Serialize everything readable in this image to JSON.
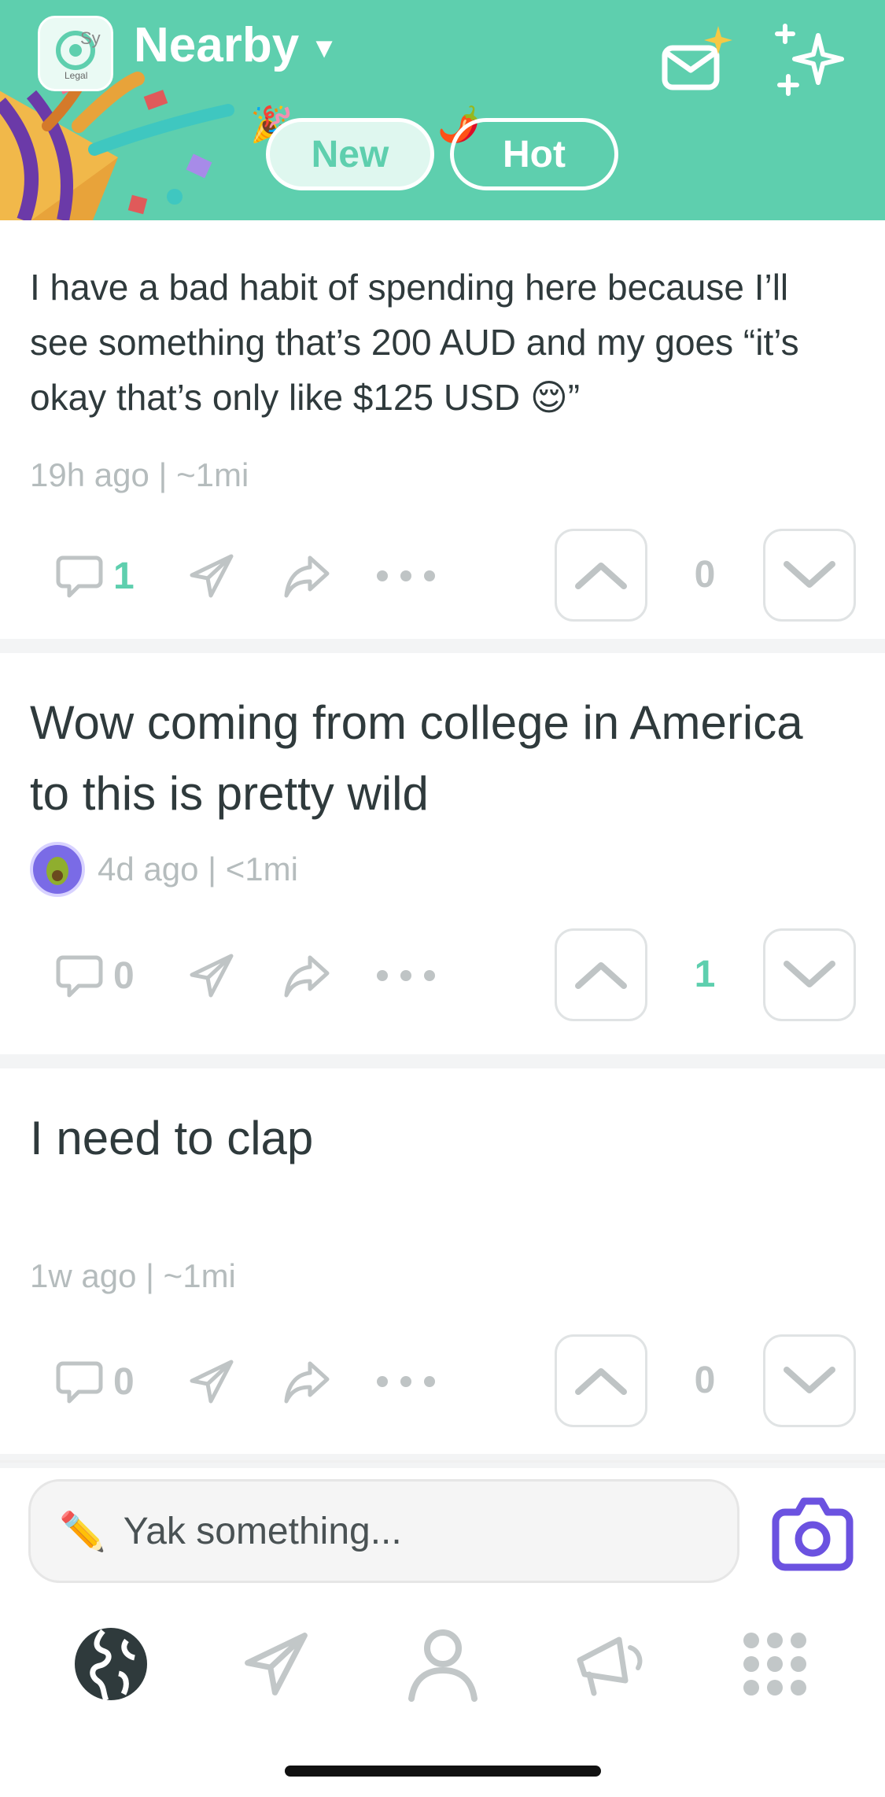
{
  "header": {
    "logo_text": "Sy",
    "logo_sub": "Legal",
    "title": "Nearby",
    "tabs": [
      {
        "label": "New",
        "active": true
      },
      {
        "label": "Hot",
        "active": false
      }
    ],
    "tab_emojis": [
      "🎉",
      "🌶️"
    ]
  },
  "posts": [
    {
      "text": "I have a bad habit of spending here because I’ll see something that’s 200 AUD and my goes “it’s okay that’s only like $125 USD 😌”",
      "meta": "19h ago | ~1mi",
      "comments": "1",
      "score": "0"
    },
    {
      "text": "Wow coming from college in America to this is pretty wild",
      "meta": "4d ago | <1mi",
      "comments": "0",
      "score": "1"
    },
    {
      "text": "I need to clap",
      "meta": "1w ago | ~1mi",
      "comments": "0",
      "score": "0"
    }
  ],
  "compose": {
    "emoji": "✏️",
    "placeholder": "Yak something..."
  },
  "colors": {
    "accent": "#5ecfae",
    "purple": "#6b52e0",
    "muted": "#bfc4c5",
    "text": "#2f3a3c"
  },
  "icons": {
    "header": [
      "inbox-sparkle-icon",
      "sparkles-icon"
    ],
    "post_actions": [
      "comment-icon",
      "send-icon",
      "share-icon",
      "more-icon",
      "upvote-icon",
      "downvote-icon"
    ],
    "bottom_nav": [
      "globe-icon",
      "send-icon",
      "profile-icon",
      "megaphone-icon",
      "grid-icon"
    ]
  }
}
